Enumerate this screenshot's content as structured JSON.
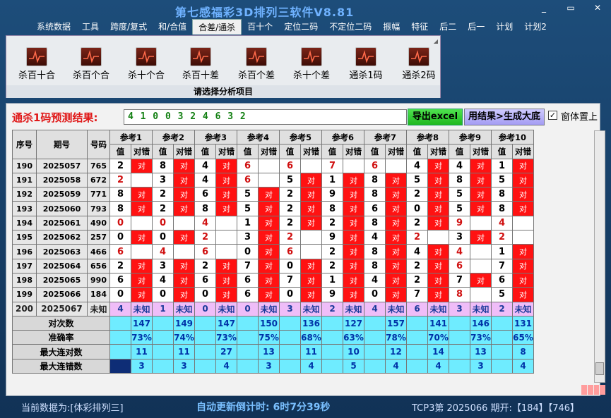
{
  "window": {
    "title": "第七感福彩3D排列三软件V8.81",
    "controls": [
      "_",
      "▭",
      "✕"
    ]
  },
  "menu": [
    "系统数据",
    "工具",
    "跨度/复式",
    "和/合值",
    "合差/通杀",
    "百十个",
    "定位二码",
    "不定位二码",
    "振幅",
    "特征",
    "后二",
    "后一",
    "计划",
    "计划2"
  ],
  "menu_active": 4,
  "ribbon": {
    "buttons": [
      "杀百十合",
      "杀百个合",
      "杀十个合",
      "杀百十差",
      "杀百个差",
      "杀十个差",
      "通杀1码",
      "通杀2码"
    ],
    "footer": "请选择分析项目"
  },
  "prediction": {
    "label": "通杀1码预测结果:",
    "value": "4 1 0 0 3 2 4 6 3 2",
    "export_label": "导出excel",
    "generate_label": "用结果>生成大底",
    "ontop_label": "窗体置上",
    "ontop_checked": true
  },
  "table": {
    "headers": {
      "seq": "序号",
      "period": "期号",
      "number": "号码",
      "value": "值",
      "hit": "对错"
    },
    "groups": [
      "参考1",
      "参考2",
      "参考3",
      "参考4",
      "参考5",
      "参考6",
      "参考7",
      "参考8",
      "参考9",
      "参考10"
    ],
    "hit_text": "对",
    "rows": [
      {
        "seq": "190",
        "period": "2025057",
        "number": "765",
        "values": [
          "2",
          "8",
          "4",
          "6",
          "6",
          "7",
          "6",
          "4",
          "4",
          "1"
        ],
        "hits": [
          1,
          1,
          1,
          0,
          0,
          0,
          0,
          1,
          1,
          1
        ],
        "red": [
          0,
          0,
          0,
          1,
          1,
          1,
          1,
          0,
          0,
          0
        ]
      },
      {
        "seq": "191",
        "period": "2025058",
        "number": "672",
        "values": [
          "2",
          "3",
          "4",
          "6",
          "5",
          "1",
          "8",
          "5",
          "8",
          "5"
        ],
        "hits": [
          0,
          1,
          1,
          0,
          1,
          1,
          1,
          1,
          1,
          1
        ],
        "red": [
          1,
          0,
          0,
          1,
          0,
          0,
          0,
          0,
          0,
          0
        ]
      },
      {
        "seq": "192",
        "period": "2025059",
        "number": "771",
        "values": [
          "8",
          "2",
          "6",
          "5",
          "2",
          "9",
          "8",
          "2",
          "5",
          "8"
        ],
        "hits": [
          1,
          1,
          1,
          1,
          1,
          1,
          1,
          1,
          1,
          1
        ],
        "red": [
          0,
          0,
          0,
          0,
          0,
          0,
          0,
          0,
          0,
          0
        ]
      },
      {
        "seq": "193",
        "period": "2025060",
        "number": "793",
        "values": [
          "8",
          "2",
          "8",
          "5",
          "2",
          "8",
          "6",
          "0",
          "5",
          "8"
        ],
        "hits": [
          1,
          1,
          1,
          1,
          1,
          1,
          1,
          1,
          1,
          1
        ],
        "red": [
          0,
          0,
          0,
          0,
          0,
          0,
          0,
          0,
          0,
          0
        ]
      },
      {
        "seq": "194",
        "period": "2025061",
        "number": "490",
        "values": [
          "0",
          "0",
          "4",
          "1",
          "2",
          "2",
          "8",
          "2",
          "9",
          "4"
        ],
        "hits": [
          0,
          0,
          0,
          1,
          1,
          1,
          1,
          1,
          0,
          0
        ],
        "red": [
          1,
          1,
          1,
          0,
          0,
          0,
          0,
          0,
          1,
          1
        ]
      },
      {
        "seq": "195",
        "period": "2025062",
        "number": "257",
        "values": [
          "0",
          "0",
          "2",
          "3",
          "2",
          "9",
          "4",
          "2",
          "3",
          "2"
        ],
        "hits": [
          1,
          1,
          0,
          1,
          0,
          1,
          1,
          0,
          1,
          0
        ],
        "red": [
          0,
          0,
          1,
          0,
          1,
          0,
          0,
          1,
          0,
          1
        ]
      },
      {
        "seq": "196",
        "period": "2025063",
        "number": "466",
        "values": [
          "6",
          "4",
          "6",
          "0",
          "6",
          "2",
          "8",
          "4",
          "4",
          "1"
        ],
        "hits": [
          0,
          0,
          0,
          1,
          0,
          1,
          1,
          1,
          0,
          1
        ],
        "red": [
          1,
          1,
          1,
          0,
          1,
          0,
          0,
          0,
          1,
          0
        ]
      },
      {
        "seq": "197",
        "period": "2025064",
        "number": "656",
        "values": [
          "2",
          "3",
          "2",
          "7",
          "0",
          "2",
          "8",
          "2",
          "6",
          "7"
        ],
        "hits": [
          1,
          1,
          1,
          1,
          1,
          1,
          1,
          1,
          0,
          1
        ],
        "red": [
          0,
          0,
          0,
          0,
          0,
          0,
          0,
          0,
          1,
          0
        ]
      },
      {
        "seq": "198",
        "period": "2025065",
        "number": "990",
        "values": [
          "6",
          "4",
          "6",
          "6",
          "7",
          "1",
          "4",
          "2",
          "7",
          "6"
        ],
        "hits": [
          1,
          1,
          1,
          1,
          1,
          1,
          1,
          1,
          1,
          1
        ],
        "red": [
          0,
          0,
          0,
          0,
          0,
          0,
          0,
          0,
          0,
          0
        ]
      },
      {
        "seq": "199",
        "period": "2025066",
        "number": "184",
        "values": [
          "0",
          "0",
          "0",
          "6",
          "0",
          "9",
          "0",
          "7",
          "8",
          "5"
        ],
        "hits": [
          1,
          1,
          1,
          1,
          1,
          1,
          1,
          1,
          0,
          1
        ],
        "red": [
          0,
          0,
          0,
          0,
          0,
          0,
          0,
          0,
          1,
          0
        ]
      },
      {
        "seq": "200",
        "period": "2025067",
        "number": "未知",
        "values": [
          "4",
          "1",
          "0",
          "0",
          "3",
          "2",
          "4",
          "6",
          "3",
          "2"
        ],
        "pending": true
      }
    ],
    "unknown_text": "未知",
    "stats": [
      {
        "label": "对次数",
        "values": [
          "147",
          "149",
          "147",
          "150",
          "136",
          "127",
          "157",
          "141",
          "146",
          "131"
        ]
      },
      {
        "label": "准确率",
        "values": [
          "73%",
          "74%",
          "73%",
          "75%",
          "68%",
          "63%",
          "78%",
          "70%",
          "73%",
          "65%"
        ]
      },
      {
        "label": "最大连对数",
        "values": [
          "11",
          "11",
          "27",
          "13",
          "11",
          "10",
          "12",
          "14",
          "13",
          "8"
        ]
      },
      {
        "label": "最大连错数",
        "values": [
          "3",
          "3",
          "4",
          "3",
          "4",
          "5",
          "4",
          "4",
          "3",
          "4"
        ]
      }
    ]
  },
  "status": {
    "data_source": "当前数据为:[体彩排列三]",
    "auto_update": "自动更新倒计时: 6时7分39秒",
    "last_draw": "TCP3第 2025066 期开:【184】【746】"
  },
  "colors": {
    "hit": "#ff1212",
    "pending": "#efbdf8",
    "stat": "#6fecff",
    "title": "#6fb2ff"
  }
}
